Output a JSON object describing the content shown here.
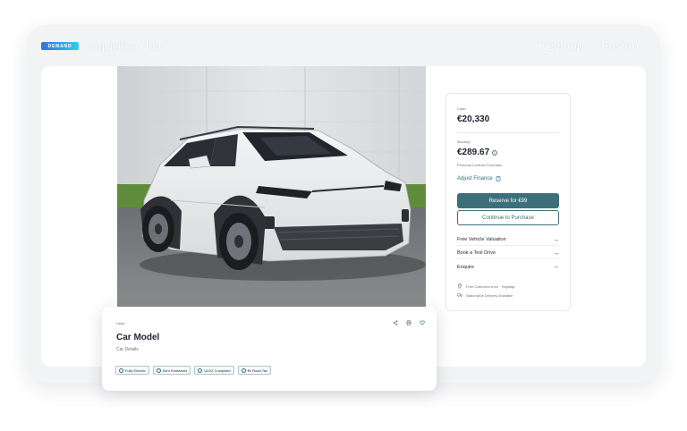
{
  "header": {
    "badge": "DEMAND",
    "title": "Acquisition Hub",
    "brand_primary": "Keyloop",
    "brand_secondary": "Fusion"
  },
  "pricing": {
    "cash_label": "Cash:",
    "cash_value": "€20,330",
    "monthly_label": "Monthly:",
    "monthly_value": "€289.67",
    "finance_type": "Personal Contract Purchase",
    "adjust_label": "Adjust Finance",
    "reserve_button": "Reserve for €99",
    "purchase_button": "Continue to Purchase"
  },
  "actions": [
    {
      "label": "Free Vehicle Valuation"
    },
    {
      "label": "Book a Test Drive"
    },
    {
      "label": "Enquire"
    }
  ],
  "delivery": {
    "collection_text": "Free Collection from",
    "collection_brand": "Keyloop",
    "delivery_text": "Nationwide Delivery Available"
  },
  "vehicle": {
    "condition": "Used",
    "title": "Car Model",
    "subtitle": "Car Details",
    "tags": [
      "Fully Electric",
      "Zero Emissions",
      "ULEZ Compliant",
      "€0 Road Tax"
    ]
  },
  "colors": {
    "accent": "#3d6f7b",
    "badge_gradient_start": "#3a6fe0",
    "badge_gradient_end": "#2bd0ee"
  },
  "icons": [
    "share-icon",
    "print-icon",
    "heart-icon",
    "info-icon",
    "calculator-icon",
    "arrow-right-icon",
    "location-pin-icon",
    "truck-icon"
  ]
}
